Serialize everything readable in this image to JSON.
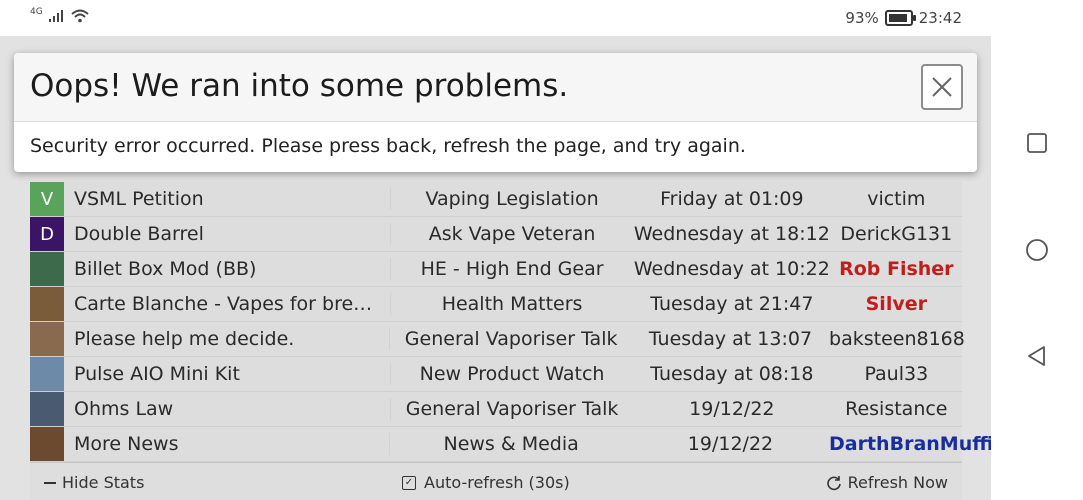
{
  "status_bar": {
    "network": "4G",
    "battery_percent": "93%",
    "battery_level": 0.93,
    "time": "23:42"
  },
  "dialog": {
    "title": "Oops! We ran into some problems.",
    "message": "Security error occurred. Please press back, refresh the page, and try again.",
    "close_icon": "close-icon"
  },
  "threads": [
    {
      "avatar_letter": "V",
      "avatar_color": "#5aa35a",
      "title": "VSML Petition",
      "forum": "Vaping Legislation",
      "date": "Friday at 01:09",
      "user": "victim",
      "user_style": "normal"
    },
    {
      "avatar_letter": "D",
      "avatar_color": "#3b1466",
      "title": "Double Barrel",
      "forum": "Ask Vape Veteran",
      "date": "Wednesday at 18:12",
      "user": "DerickG131",
      "user_style": "normal"
    },
    {
      "avatar_letter": "",
      "avatar_color": "#3d6a4a",
      "title": "Billet Box Mod (BB)",
      "forum": "HE - High End Gear",
      "date": "Wednesday at 10:22",
      "user": "Rob Fisher",
      "user_style": "red"
    },
    {
      "avatar_letter": "",
      "avatar_color": "#7a5c3a",
      "title": "Carte Blanche - Vapes for bre…",
      "forum": "Health Matters",
      "date": "Tuesday at 21:47",
      "user": "Silver",
      "user_style": "red"
    },
    {
      "avatar_letter": "",
      "avatar_color": "#8a6a4e",
      "title": "Please help me decide.",
      "forum": "General Vaporiser Talk",
      "date": "Tuesday at 13:07",
      "user": "baksteen8168",
      "user_style": "normal"
    },
    {
      "avatar_letter": "",
      "avatar_color": "#6d8aa8",
      "title": "Pulse AIO Mini Kit",
      "forum": "New Product Watch",
      "date": "Tuesday at 08:18",
      "user": "Paul33",
      "user_style": "normal"
    },
    {
      "avatar_letter": "",
      "avatar_color": "#4a5a70",
      "title": "Ohms Law",
      "forum": "General Vaporiser Talk",
      "date": "19/12/22",
      "user": "Resistance",
      "user_style": "normal"
    },
    {
      "avatar_letter": "",
      "avatar_color": "#6b4a30",
      "title": "More News",
      "forum": "News & Media",
      "date": "19/12/22",
      "user": "DarthBranMuffin",
      "user_style": "blue"
    }
  ],
  "stats_bar": {
    "hide_stats": "Hide Stats",
    "auto_refresh": "Auto-refresh (30s)",
    "auto_refresh_checked": true,
    "refresh_now": "Refresh Now"
  },
  "nav": {
    "recents_icon": "square-icon",
    "home_icon": "circle-icon",
    "back_icon": "triangle-back-icon"
  }
}
